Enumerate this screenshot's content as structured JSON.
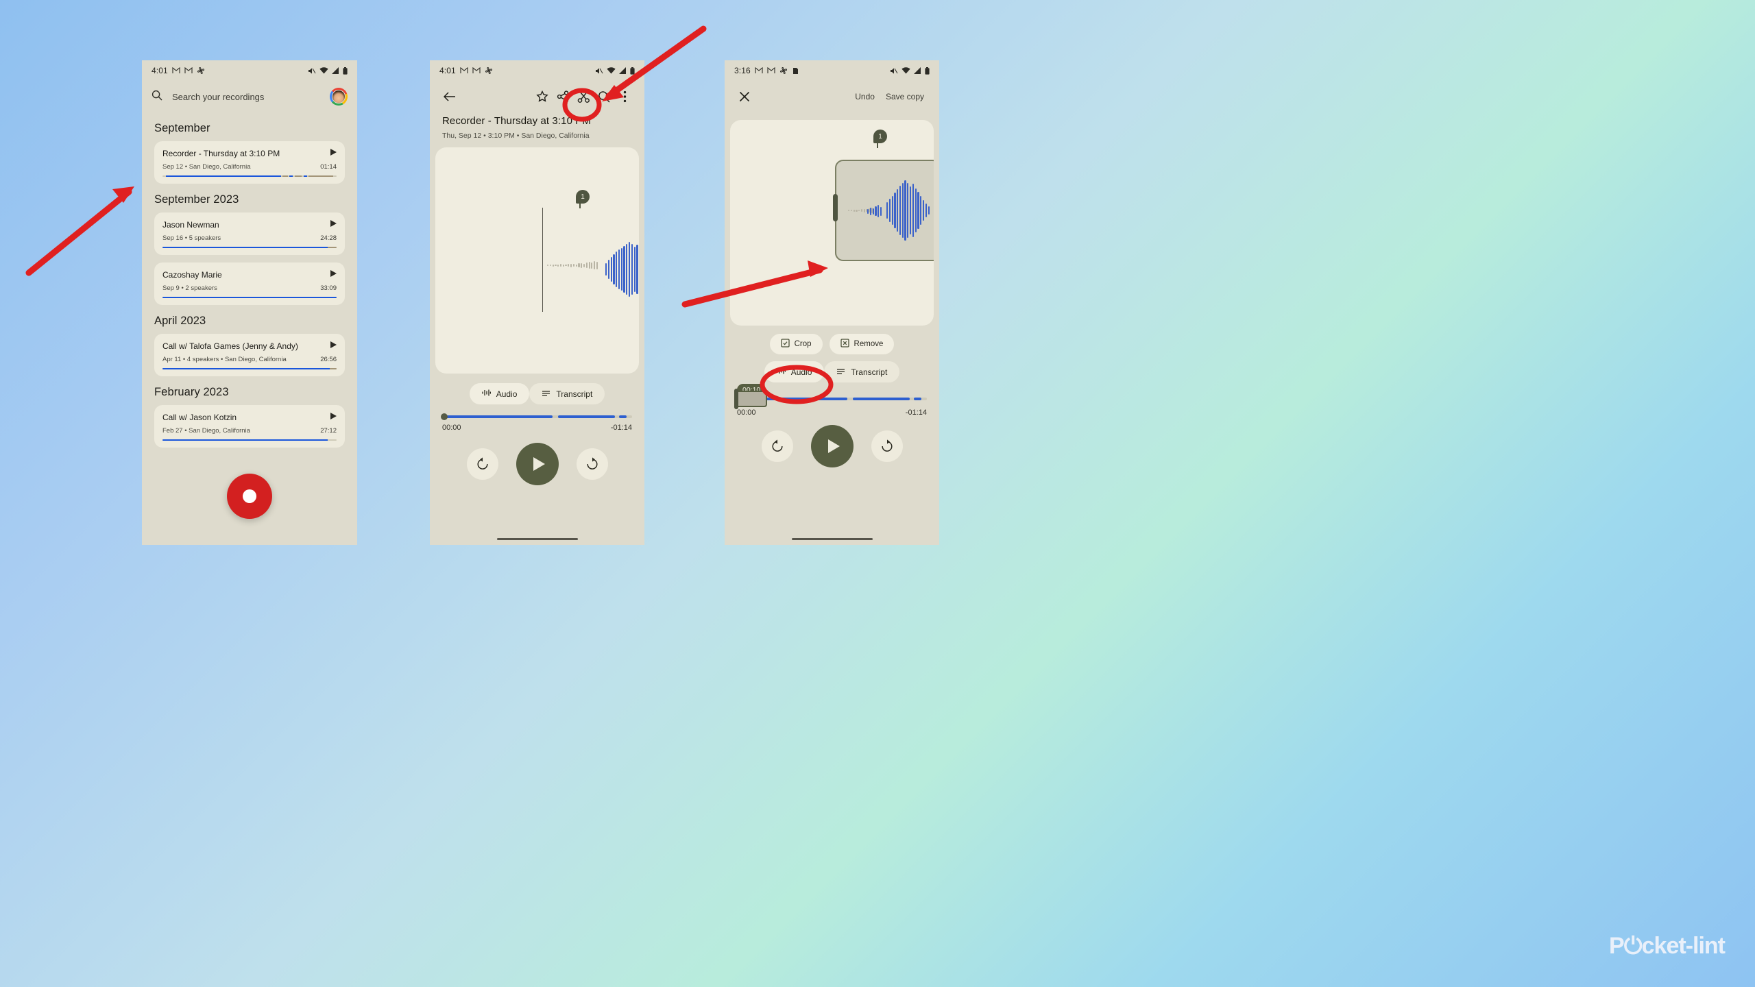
{
  "background": {
    "gradient_from": "#8fc0f0",
    "gradient_to": "#8ec3f2"
  },
  "watermark": {
    "text_before": "P",
    "text_after": "cket-lint",
    "accent": "#e8607a"
  },
  "phone1": {
    "statusbar": {
      "time": "4:01",
      "icons": [
        "gmail-icon",
        "gmail-icon",
        "photos-icon"
      ],
      "right_icons": [
        "mute-icon",
        "wifi-icon",
        "signal-icon",
        "battery-icon"
      ]
    },
    "search": {
      "placeholder": "Search your recordings",
      "icon": "search-icon",
      "avatar": "user-avatar"
    },
    "sections": [
      {
        "title": "September",
        "items": [
          {
            "title": "Recorder - Thursday at 3:10 PM",
            "subtitle": "Sep 12 • San Diego, California",
            "duration": "01:14",
            "progress": 100
          }
        ]
      },
      {
        "title": "September 2023",
        "items": [
          {
            "title": "Jason Newman",
            "subtitle": "Sep 16 • 5 speakers",
            "duration": "24:28",
            "progress": 96
          },
          {
            "title": "Cazoshay Marie",
            "subtitle": "Sep 9 • 2 speakers",
            "duration": "33:09",
            "progress": 100
          }
        ]
      },
      {
        "title": "April 2023",
        "items": [
          {
            "title": "Call w/ Talofa Games (Jenny & Andy)",
            "subtitle": "Apr 11 • 4 speakers • San Diego, California",
            "duration": "26:56",
            "progress": 97
          }
        ]
      },
      {
        "title": "February 2023",
        "items": [
          {
            "title": "Call w/ Jason Kotzin",
            "subtitle": "Feb 27 • San Diego, California",
            "duration": "27:12",
            "progress": 95
          }
        ]
      }
    ],
    "record_button": "record-button"
  },
  "phone2": {
    "statusbar": {
      "time": "4:01",
      "icons": [
        "gmail-icon",
        "gmail-icon",
        "photos-icon"
      ],
      "right_icons": [
        "mute-icon",
        "wifi-icon",
        "signal-icon",
        "battery-icon"
      ]
    },
    "toolbar": {
      "back": "back-arrow-icon",
      "star": "star-icon",
      "share": "share-icon",
      "trim": "scissors-icon",
      "search": "search-icon",
      "more": "more-vertical-icon"
    },
    "title": "Recorder - Thursday at 3:10 PM",
    "subtitle": "Thu, Sep 12 • 3:10 PM • San Diego, California",
    "marker_label": "1",
    "tabs": [
      {
        "label": "Audio",
        "icon": "waveform-icon",
        "active": true
      },
      {
        "label": "Transcript",
        "icon": "lines-icon",
        "active": false
      }
    ],
    "player": {
      "elapsed": "00:00",
      "remaining": "-01:14",
      "position_pct": 0
    },
    "transport": {
      "rewind": "replay-10-icon",
      "play": "play-icon",
      "forward": "forward-10-icon"
    }
  },
  "phone3": {
    "statusbar": {
      "time": "3:16",
      "icons": [
        "gmail-icon",
        "gmail-icon",
        "photos-icon",
        "app-icon"
      ],
      "right_icons": [
        "mute-icon",
        "wifi-icon",
        "signal-icon",
        "battery-icon"
      ]
    },
    "toolbar": {
      "close": "close-icon",
      "undo": "Undo",
      "save": "Save copy"
    },
    "marker_label": "1",
    "edit_actions": [
      {
        "label": "Crop",
        "icon": "crop-icon",
        "highlighted": true
      },
      {
        "label": "Remove",
        "icon": "remove-icon",
        "highlighted": false
      }
    ],
    "tabs": [
      {
        "label": "Audio",
        "icon": "waveform-icon",
        "active": true
      },
      {
        "label": "Transcript",
        "icon": "lines-icon",
        "active": false
      }
    ],
    "trim_tooltip": "00:10",
    "player": {
      "elapsed": "00:00",
      "remaining": "-01:14"
    },
    "transport": {
      "rewind": "replay-10-icon",
      "play": "play-icon",
      "forward": "forward-10-icon"
    }
  },
  "annotations": {
    "arrow1": "red-arrow-pointing-to-recording",
    "arrow2": "red-arrow-pointing-to-scissors",
    "arrow3": "red-arrow-pointing-to-crop-handle",
    "circle_scissors": "red-ellipse-around-scissors",
    "circle_crop": "red-ellipse-around-crop-button",
    "color": "#e02020"
  }
}
